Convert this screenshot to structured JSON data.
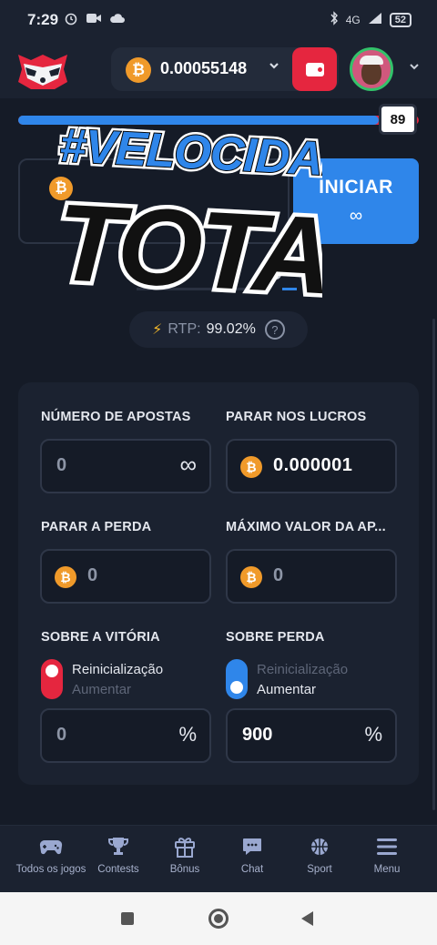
{
  "status_bar": {
    "time": "7:29",
    "signal": "4G",
    "battery": "52"
  },
  "header": {
    "balance": "0.00055148",
    "currency_symbol": "₿"
  },
  "game": {
    "slider_value": "89",
    "slider_fraction": 0.9,
    "start_label": "INICIAR",
    "start_sub": "∞",
    "overlay_line1": "#VELOCIDADE",
    "overlay_line2": "TOTAL",
    "rtp_label": "RTP:",
    "rtp_value": "99.02%"
  },
  "autobet": {
    "num_bets_label": "NÚMERO DE APOSTAS",
    "num_bets_value": "0",
    "num_bets_suffix": "∞",
    "stop_profit_label": "PARAR NOS LUCROS",
    "stop_profit_value": "0.000001",
    "stop_loss_label": "PARAR A PERDA",
    "stop_loss_value": "0",
    "max_bet_label": "MÁXIMO VALOR DA AP...",
    "max_bet_value": "0",
    "on_win_label": "SOBRE A VITÓRIA",
    "on_win_reset": "Reinicialização",
    "on_win_increase": "Aumentar",
    "on_win_value": "0",
    "on_win_suffix": "%",
    "on_loss_label": "SOBRE PERDA",
    "on_loss_reset": "Reinicialização",
    "on_loss_increase": "Aumentar",
    "on_loss_value": "900",
    "on_loss_suffix": "%"
  },
  "bottom_nav": [
    {
      "label": "Todos os jogos",
      "icon": "gamepad-icon"
    },
    {
      "label": "Contests",
      "icon": "trophy-icon"
    },
    {
      "label": "Bônus",
      "icon": "gift-icon"
    },
    {
      "label": "Chat",
      "icon": "chat-icon"
    },
    {
      "label": "Sport",
      "icon": "ball-icon"
    },
    {
      "label": "Menu",
      "icon": "menu-icon"
    }
  ],
  "colors": {
    "accent_blue": "#2f86ea",
    "accent_red": "#e5263f",
    "bitcoin": "#f09a2a",
    "background": "#151b27"
  }
}
